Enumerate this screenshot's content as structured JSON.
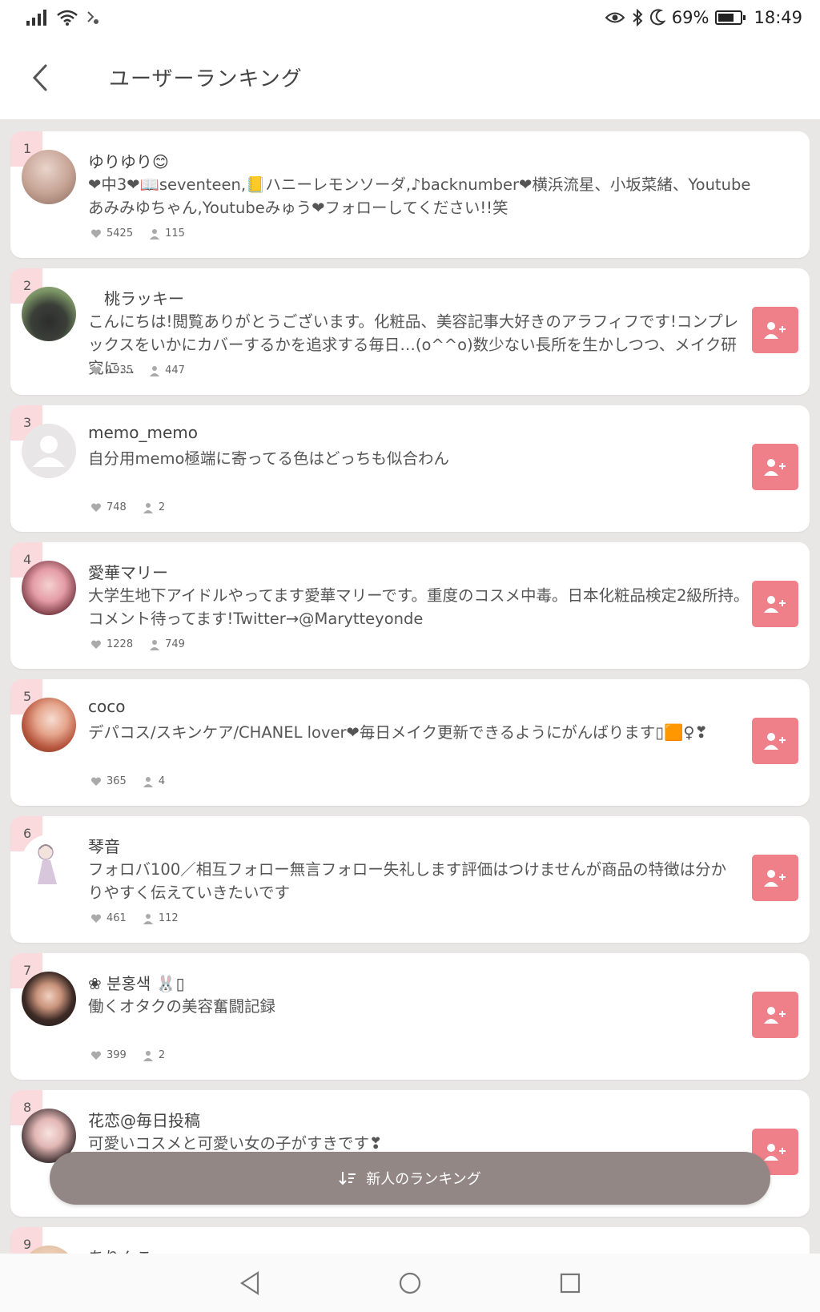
{
  "status_bar": {
    "battery": "69%",
    "time": "18:49"
  },
  "header": {
    "title": "ユーザーランキング"
  },
  "users": [
    {
      "rank": "1",
      "name": "ゆりゆり😊",
      "bio": "❤中3❤📖seventeen,📒ハニーレモンソーダ,♪backnumber❤横浜流星、小坂菜緒、Youtubeあみみゆちゃん,Youtubeみゅう❤フォローしてください!!笑",
      "likes": "5425",
      "followers": "115",
      "has_follow_button": false
    },
    {
      "rank": "2",
      "name": "桃ラッキー",
      "bio": "こんにちは!閲覧ありがとうございます。化粧品、美容記事大好きのアラフィフです!コンプレックスをいかにカバーするかを追求する毎日…(o^^o)数少ない長所を生かしつつ、メイク研究に…",
      "likes": "1935",
      "followers": "447",
      "has_follow_button": true
    },
    {
      "rank": "3",
      "name": "memo_memo",
      "bio": "自分用memo極端に寄ってる色はどっちも似合わん",
      "likes": "748",
      "followers": "2",
      "has_follow_button": true
    },
    {
      "rank": "4",
      "name": "愛華マリー",
      "bio": "大学生地下アイドルやってます愛華マリーです。重度のコスメ中毒。日本化粧品検定2級所持。コメント待ってます!Twitter→@Marytteyonde",
      "likes": "1228",
      "followers": "749",
      "has_follow_button": true
    },
    {
      "rank": "5",
      "name": "coco",
      "bio": "デパコス/スキンケア/CHANEL lover❤毎日メイク更新できるようにがんばります▯🟧♀❣",
      "likes": "365",
      "followers": "4",
      "has_follow_button": true
    },
    {
      "rank": "6",
      "name": "琴音",
      "bio": "フォロバ100／相互フォロー無言フォロー失礼します評価はつけませんが商品の特徴は分かりやすく伝えていきたいです",
      "likes": "461",
      "followers": "112",
      "has_follow_button": true
    },
    {
      "rank": "7",
      "name": "❀ 분홍색 🐰▯",
      "bio": "働くオタクの美容奮闘記録",
      "likes": "399",
      "followers": "2",
      "has_follow_button": true
    },
    {
      "rank": "8",
      "name": "花恋@毎日投稿",
      "bio": "可愛いコスメと可愛い女の子がすきです❣",
      "likes": "",
      "followers": "",
      "has_follow_button": true
    },
    {
      "rank": "9",
      "name": "ありんこ",
      "bio": "",
      "likes": "",
      "followers": "",
      "has_follow_button": false
    }
  ],
  "fab": {
    "label": "新人のランキング"
  },
  "icons": {
    "back": "chevron-left-icon",
    "like": "heart-icon",
    "follower": "person-icon",
    "follow": "add-user-icon",
    "sort": "sort-icon"
  },
  "colors": {
    "accent": "#ef7f88",
    "rank_badge": "#fadadd",
    "fab": "#928785"
  }
}
